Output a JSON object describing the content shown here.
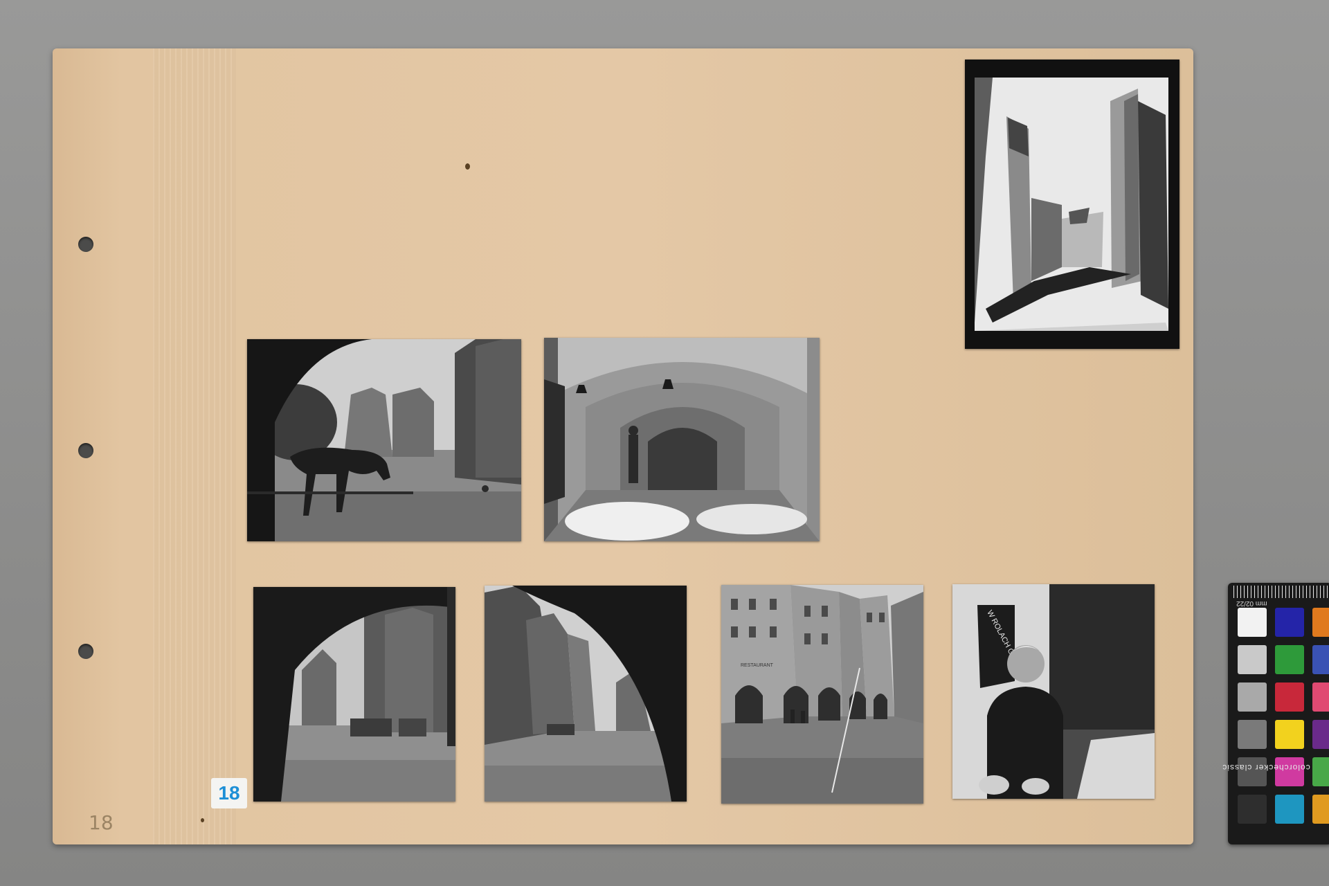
{
  "album_page": {
    "page_badge": "18",
    "pencil_number": "18"
  },
  "photos": [
    {
      "subject": "watercolor-street-painting"
    },
    {
      "subject": "horses-under-arcade"
    },
    {
      "subject": "arcade-walkway-lanterns"
    },
    {
      "subject": "square-through-arch"
    },
    {
      "subject": "street-through-arch"
    },
    {
      "subject": "town-houses-with-arcades",
      "sign_text": "RESTAURANT"
    },
    {
      "subject": "boy-by-wall-poster",
      "poster_text": "W ROLACH GŁO"
    }
  ],
  "color_checker": {
    "ruler_label": "mm",
    "date_label": "02/22",
    "brand": "colorchecker classic",
    "swatches": [
      "#f2f2f2",
      "#2424a8",
      "#e07a1e",
      "#c9c9c9",
      "#2e9a3a",
      "#3a52b4",
      "#a9a9a9",
      "#c8283a",
      "#e04a72",
      "#7a7a7a",
      "#f2d21e",
      "#6a2a8a",
      "#555555",
      "#d03aa0",
      "#48a848",
      "#2e2e2e",
      "#1e96c0",
      "#e09a20"
    ]
  }
}
